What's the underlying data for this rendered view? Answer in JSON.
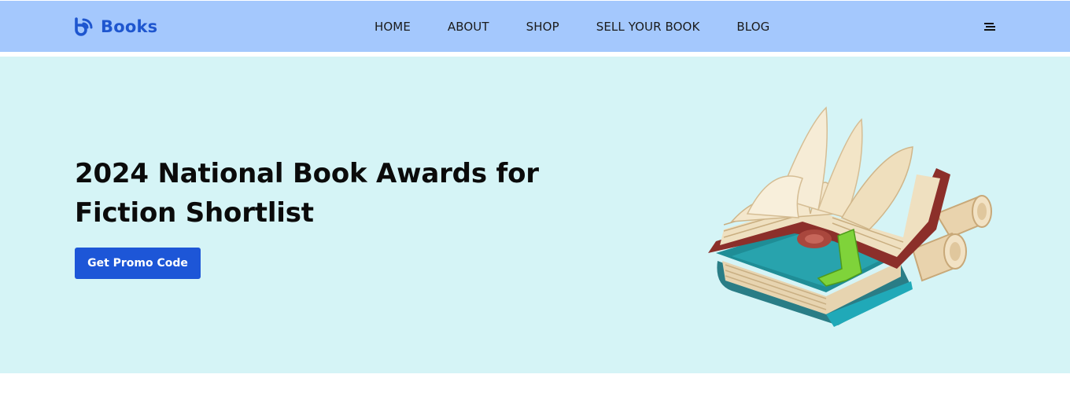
{
  "brand": {
    "name": "Books",
    "logo_icon": "rss-book-icon",
    "color": "#1e56cf"
  },
  "nav": {
    "items": [
      {
        "label": "HOME"
      },
      {
        "label": "ABOUT"
      },
      {
        "label": "SHOP"
      },
      {
        "label": "SELL YOUR BOOK"
      },
      {
        "label": "BLOG"
      }
    ],
    "menu_icon": "hamburger-menu-icon",
    "background": "#a4c8fd"
  },
  "hero": {
    "title": "2024 National Book Awards for Fiction Shortlist",
    "cta_label": "Get Promo Code",
    "cta_color": "#1d56d7",
    "background": "#d5f4f6",
    "illustration": "open-book-stack-with-scrolls-illustration"
  }
}
